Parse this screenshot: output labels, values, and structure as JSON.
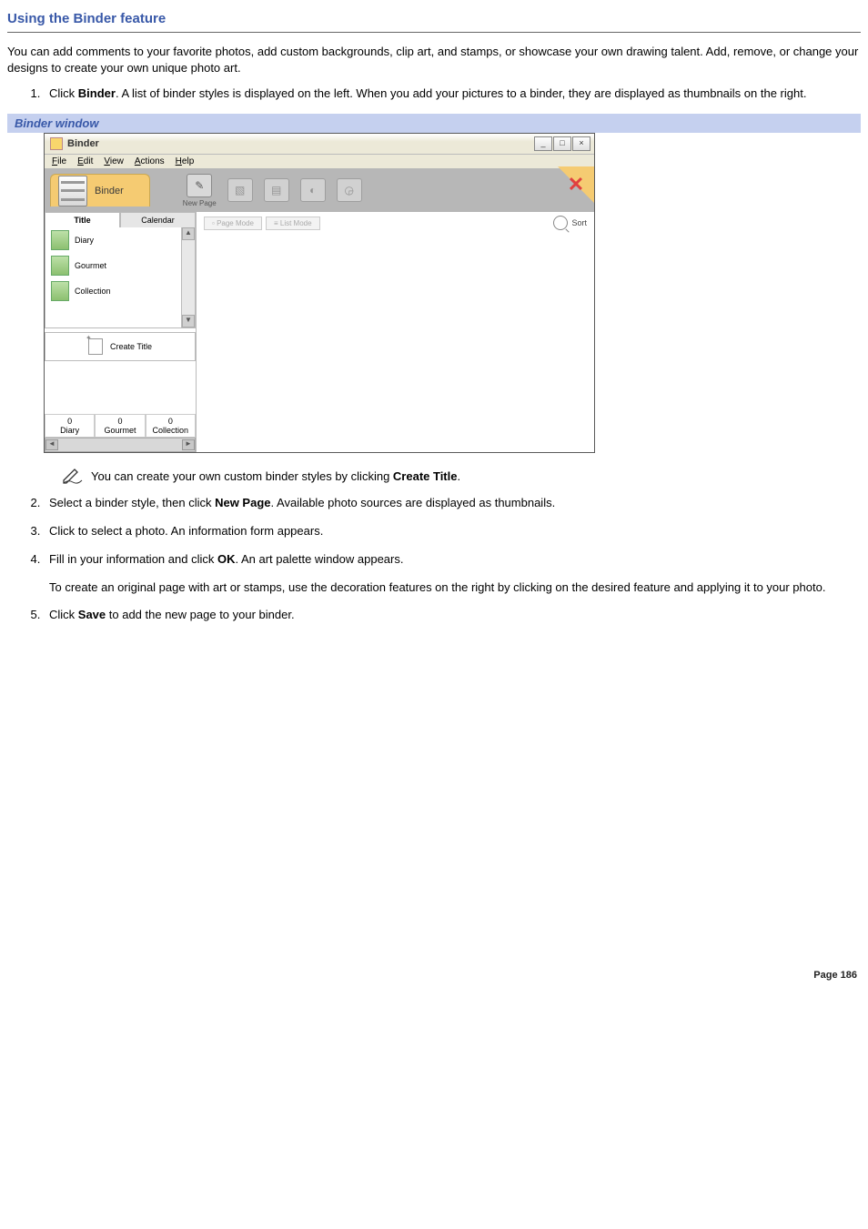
{
  "page": {
    "title": "Using the Binder feature",
    "caption": "Binder window",
    "footer": "Page 186"
  },
  "intro": "You can add comments to your favorite photos, add custom backgrounds, clip art, and stamps, or showcase your own drawing talent. Add, remove, or change your designs to create your own unique photo art.",
  "steps": {
    "s1a": "Click ",
    "s1b": "Binder",
    "s1c": ". A list of binder styles is displayed on the left. When you add your pictures to a binder, they are displayed as thumbnails on the right.",
    "tip_a": "You can create your own custom binder styles by clicking ",
    "tip_b": "Create Title",
    "tip_c": ".",
    "s2a": "Select a binder style, then click ",
    "s2b": "New Page",
    "s2c": ". Available photo sources are displayed as thumbnails.",
    "s3": "Click to select a photo. An information form appears.",
    "s4a": "Fill in your information and click ",
    "s4b": "OK",
    "s4c": ". An art palette window appears.",
    "s4p": "To create an original page with art or stamps, use the decoration features on the right by clicking on the desired feature and applying it to your photo.",
    "s5a": "Click ",
    "s5b": "Save",
    "s5c": " to add the new page to your binder."
  },
  "window": {
    "title": "Binder",
    "menus": {
      "file": "File",
      "edit": "Edit",
      "view": "View",
      "actions": "Actions",
      "help": "Help"
    },
    "tab": "Binder",
    "tool_newpage": "New Page",
    "sidebar_tabs": {
      "title": "Title",
      "calendar": "Calendar"
    },
    "styles": [
      "Diary",
      "Gourmet",
      "Collection"
    ],
    "create_title": "Create Title",
    "counts": [
      {
        "n": "0",
        "label": "Diary"
      },
      {
        "n": "0",
        "label": "Gourmet"
      },
      {
        "n": "0",
        "label": "Collection"
      }
    ],
    "mode": {
      "page": "Page Mode",
      "list": "List Mode"
    },
    "sort": "Sort"
  }
}
